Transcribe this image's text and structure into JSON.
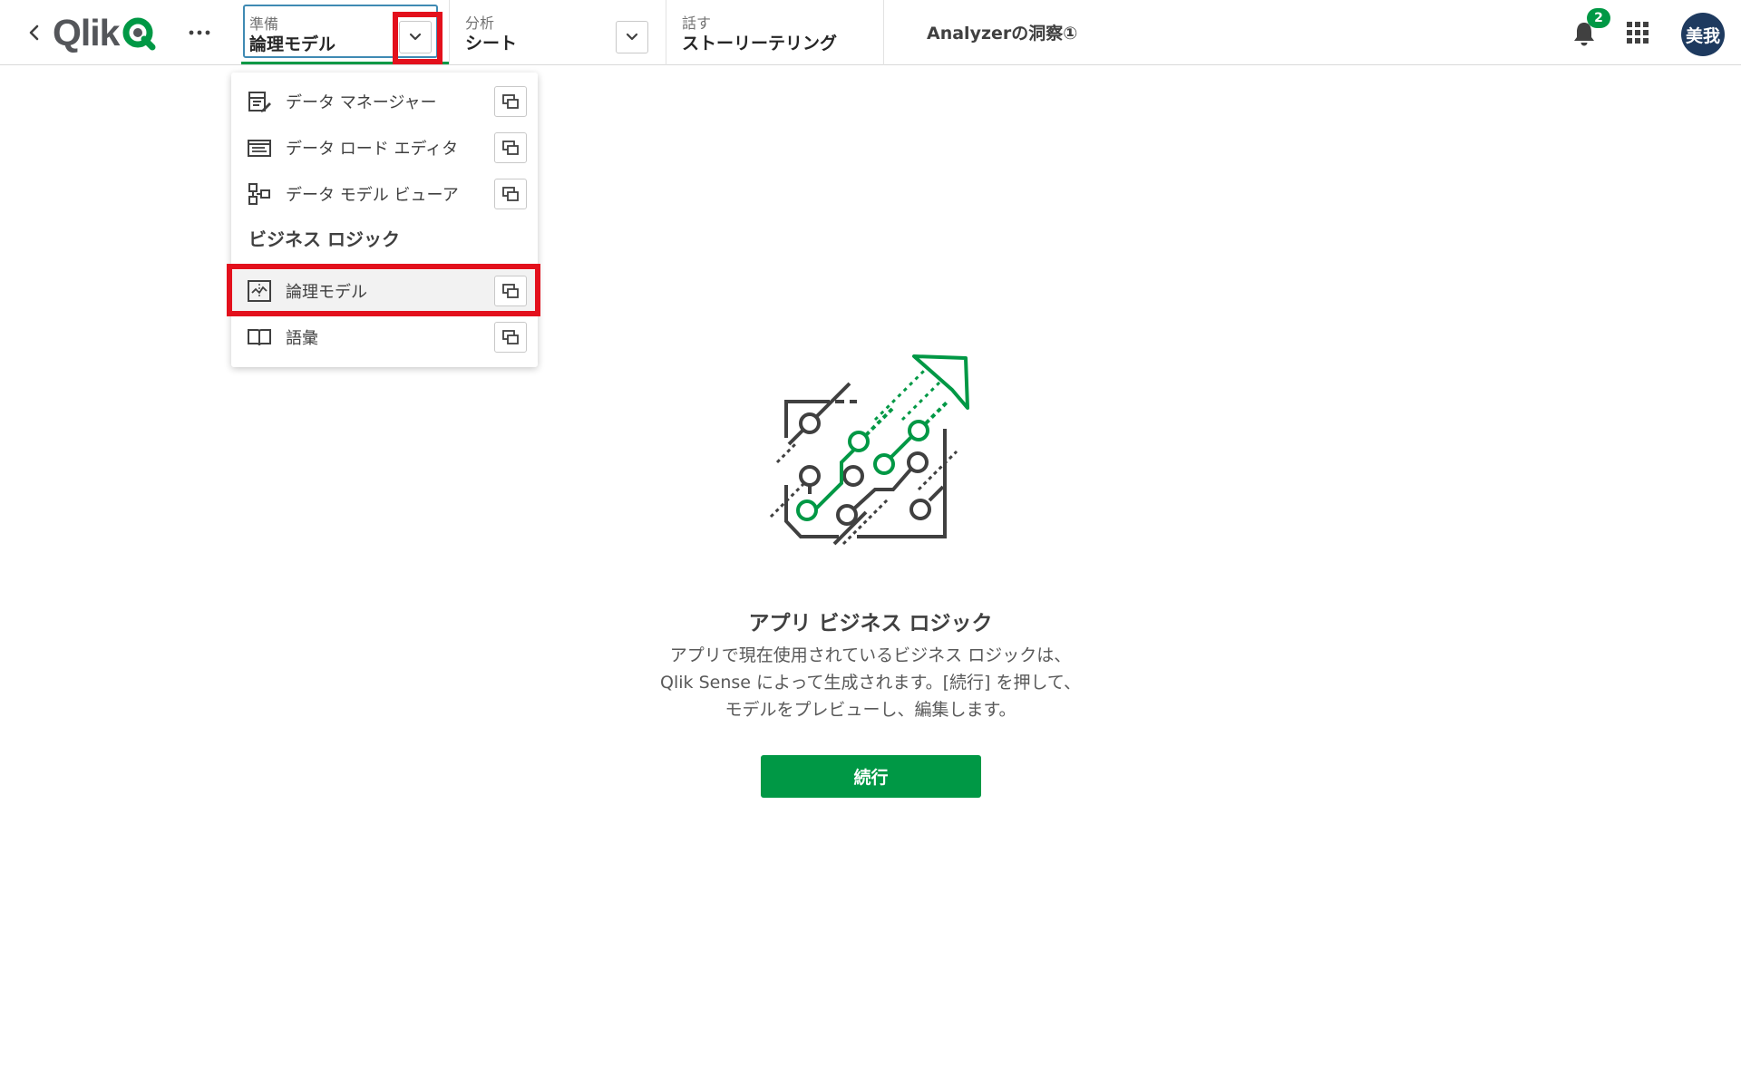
{
  "topbar": {
    "logo_text": "Qlik",
    "more_icon": "more-horizontal-icon",
    "tabs": [
      {
        "category": "準備",
        "value": "論理モデル"
      },
      {
        "category": "分析",
        "value": "シート"
      },
      {
        "category": "話す",
        "value": "ストーリーテリング"
      }
    ],
    "app_title": "Analyzerの洞察①",
    "notification_count": "2",
    "avatar_initials": "美我"
  },
  "menu": {
    "items": [
      {
        "label": "データ マネージャー",
        "icon": "data-manager-icon"
      },
      {
        "label": "データ ロード エディタ",
        "icon": "data-load-editor-icon"
      },
      {
        "label": "データ モデル ビューア",
        "icon": "data-model-viewer-icon"
      }
    ],
    "section_title": "ビジネス ロジック",
    "business_items": [
      {
        "label": "論理モデル",
        "icon": "logic-model-icon",
        "active": true
      },
      {
        "label": "語彙",
        "icon": "vocabulary-book-icon"
      }
    ]
  },
  "main": {
    "title": "アプリ ビジネス ロジック",
    "description": [
      "アプリで現在使用されているビジネス ロジックは、",
      "Qlik Sense によって生成されます。[続行] を押して、",
      "モデルをプレビューし、編集します。"
    ],
    "continue_label": "続行"
  },
  "colors": {
    "accent_green": "#009845",
    "focus_blue": "#3f8ab3",
    "highlight_red": "#e3101c",
    "avatar_navy": "#1e3a5f"
  }
}
